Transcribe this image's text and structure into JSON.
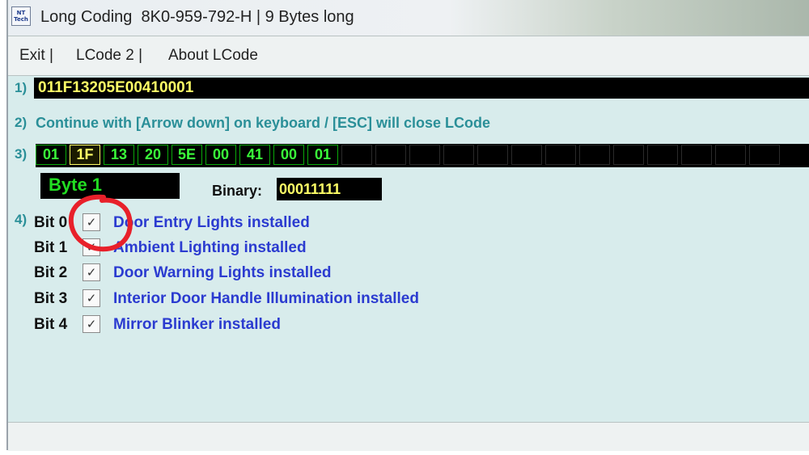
{
  "window": {
    "title": "Long Coding  8K0-959-792-H | 9 Bytes long",
    "icon": "app-logo-icon",
    "icon_text": "NT Tech"
  },
  "menu": {
    "items": [
      "Exit |",
      "LCode 2 |",
      "About LCode"
    ]
  },
  "row_labels": [
    "1)",
    "2)",
    "3)",
    "4)"
  ],
  "coding": {
    "value": "011F13205E00410001",
    "hint": "Continue with [Arrow down] on keyboard / [ESC] will close LCode"
  },
  "bytes": [
    "01",
    "1F",
    "13",
    "20",
    "5E",
    "00",
    "41",
    "00",
    "01"
  ],
  "selected_byte_index": 1,
  "selected": {
    "byte_label": "Byte 1",
    "binary_label": "Binary:",
    "binary_value": "00011111"
  },
  "bits": [
    {
      "label": "Bit 0",
      "text": "Door Entry Lights installed",
      "checked": true
    },
    {
      "label": "Bit 1",
      "text": "Ambient Lighting installed",
      "checked": true
    },
    {
      "label": "Bit 2",
      "text": "Door Warning Lights installed",
      "checked": true
    },
    {
      "label": "Bit 3",
      "text": "Interior Door Handle Illumination installed",
      "checked": true
    },
    {
      "label": "Bit 4",
      "text": "Mirror Blinker installed",
      "checked": true
    }
  ],
  "colors": {
    "accent_teal": "#2a8f98",
    "bit_text_blue": "#2b3bd0",
    "byte_green": "#3aff3a",
    "highlight_yellow": "#ffff66",
    "annotation_red": "#e8202a"
  }
}
